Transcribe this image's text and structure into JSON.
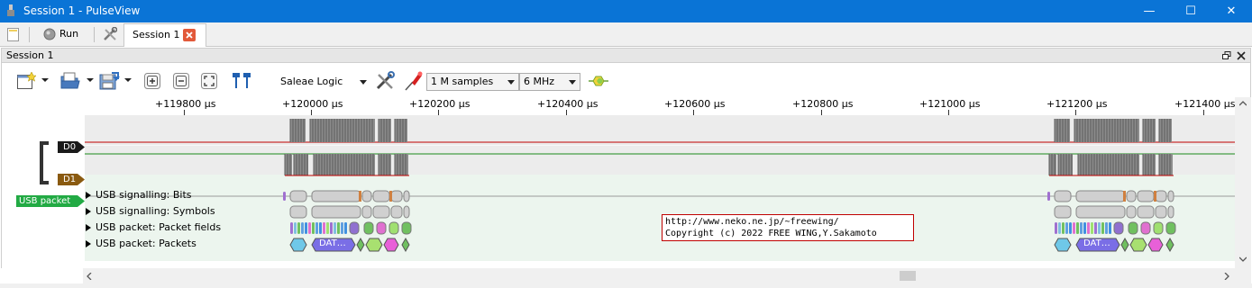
{
  "window": {
    "title": "Session 1 - PulseView",
    "controls": {
      "minimize": "—",
      "maximize": "☐",
      "close": "✕"
    }
  },
  "tabbar": {
    "run_label": "Run",
    "session_tab_label": "Session 1"
  },
  "dock": {
    "title": "Session 1"
  },
  "toolbar": {
    "device": "Saleae Logic",
    "samples": "1 M samples",
    "samplerate": "6 MHz"
  },
  "ruler": {
    "unit": "µs",
    "ticks": [
      "+119800 µs",
      "+120000 µs",
      "+120200 µs",
      "+120400 µs",
      "+120600 µs",
      "+120800 µs",
      "+121000 µs",
      "+121200 µs",
      "+121400 µs"
    ]
  },
  "channels": [
    {
      "name": "D0",
      "color": "#1a1a1a",
      "trace_color": "#c00000"
    },
    {
      "name": "D1",
      "color": "#8a5a10",
      "trace_color": "#1a8a1a"
    }
  ],
  "decoder": {
    "name": "USB packet",
    "color": "#22aa44",
    "rows": [
      "USB signalling: Bits",
      "USB signalling: Symbols",
      "USB packet: Packet fields",
      "USB packet: Packets"
    ],
    "dat_label": "DAT…"
  },
  "watermark": {
    "line1": "http://www.neko.ne.jp/~freewing/",
    "line2": "Copyright (c) 2022 FREE WING,Y.Sakamoto"
  }
}
